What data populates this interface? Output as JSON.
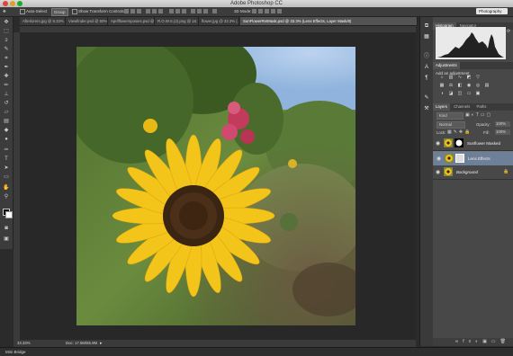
{
  "app": {
    "title": "Adobe Photoshop CC"
  },
  "window_colors": {
    "close": "#e0443e",
    "minimize": "#dea123",
    "zoom": "#1aab29"
  },
  "options_bar": {
    "auto_select_label": "Auto-Select",
    "auto_select_value": "Group",
    "show_transform_label": "Show Transform Controls",
    "mode_3d_label": "3D Mode:",
    "workspace": "Photography"
  },
  "tabs": [
    {
      "label": "Afterlorem.jpg @ 8.33%..."
    },
    {
      "label": "Viewfinder.psd @ 50% C..."
    },
    {
      "label": "Aprilflowersposies.psd @..."
    },
    {
      "label": "R.O.W.S.(2).png @ 16.7%..."
    },
    {
      "label": "flower.jpg @ 33.3% (..."
    },
    {
      "label": "SunFlowerRetMask.psd @ 33.3% (Lens Effects, Layer Mask/8)",
      "active": true
    }
  ],
  "status": {
    "zoom": "33.33%",
    "doc": "Doc: 17.5M/65.9M"
  },
  "bottom": {
    "mini_bridge": "Mini Bridge"
  },
  "panels": {
    "histogram_tabs": [
      "Histogram",
      "Navigator"
    ],
    "adjustments_tab": "Adjustments",
    "adjustments_hint": "Add an adjustment",
    "layers_tabs": [
      "Layers",
      "Channels",
      "Paths"
    ],
    "kind": "Kind",
    "blend_mode": "Normal",
    "opacity_label": "Opacity:",
    "opacity": "100%",
    "lock_label": "Lock:",
    "fill_label": "Fill:",
    "fill": "100%"
  },
  "layers": [
    {
      "name": "Sunflower Masked"
    },
    {
      "name": "Lens Effects",
      "selected": true
    },
    {
      "name": "Background"
    }
  ]
}
